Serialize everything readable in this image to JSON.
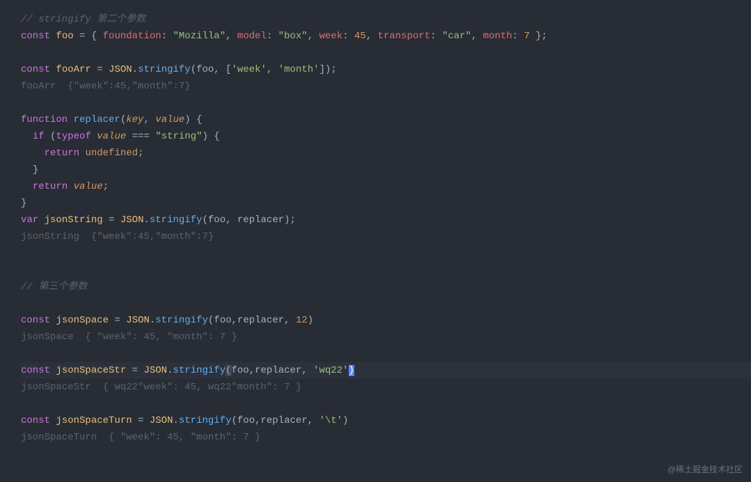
{
  "code": {
    "c1": "// stringify 第二个参数",
    "l2_const": "const",
    "l2_foo": "foo",
    "l2_eq": " = { ",
    "l2_foundation": "foundation",
    "l2_c1": ": ",
    "l2_mozilla": "\"Mozilla\"",
    "l2_c2": ", ",
    "l2_model": "model",
    "l2_box": "\"box\"",
    "l2_week": "week",
    "l2_45": "45",
    "l2_transport": "transport",
    "l2_car": "\"car\"",
    "l2_month": "month",
    "l2_7": "7",
    "l2_end": " };",
    "l4_fooArr": "fooArr",
    "l4_json": "JSON",
    "l4_stringify": "stringify",
    "l4_args_open": "(foo, [",
    "l4_weekstr": "'week'",
    "l4_monthstr": "'month'",
    "l4_args_close": "]);",
    "l5_result": "fooArr  {\"week\":45,\"month\":7}",
    "l7_function": "function",
    "l7_replacer": "replacer",
    "l7_p1": "key",
    "l7_p2": "value",
    "l8_if": "if",
    "l8_typeof": "typeof",
    "l8_value": "value",
    "l8_eqeqeq": " === ",
    "l8_string": "\"string\"",
    "l9_return": "return",
    "l9_undef": "undefined",
    "l11_return": "return",
    "l11_value": "value",
    "l13_var": "var",
    "l13_jsonString": "jsonString",
    "l13_args": "(foo, replacer);",
    "l14_result": "jsonString  {\"week\":45,\"month\":7}",
    "c3": "// 第三个参数",
    "l17_jsonSpace": "jsonSpace",
    "l17_args": "(foo,replacer, ",
    "l17_12": "12",
    "l18_result": "jsonSpace  { \"week\": 45, \"month\": 7 }",
    "l19_jsonSpaceStr": "jsonSpaceStr",
    "l19_wq22": "'wq22'",
    "l20_result": "jsonSpaceStr  { wq22\"week\": 45, wq22\"month\": 7 }",
    "l21_jsonSpaceTurn": "jsonSpaceTurn",
    "l21_tab": "'\\t'",
    "l22_result": "jsonSpaceTurn  { \"week\": 45, \"month\": 7 }"
  },
  "watermark": "@稀土掘金技术社区"
}
